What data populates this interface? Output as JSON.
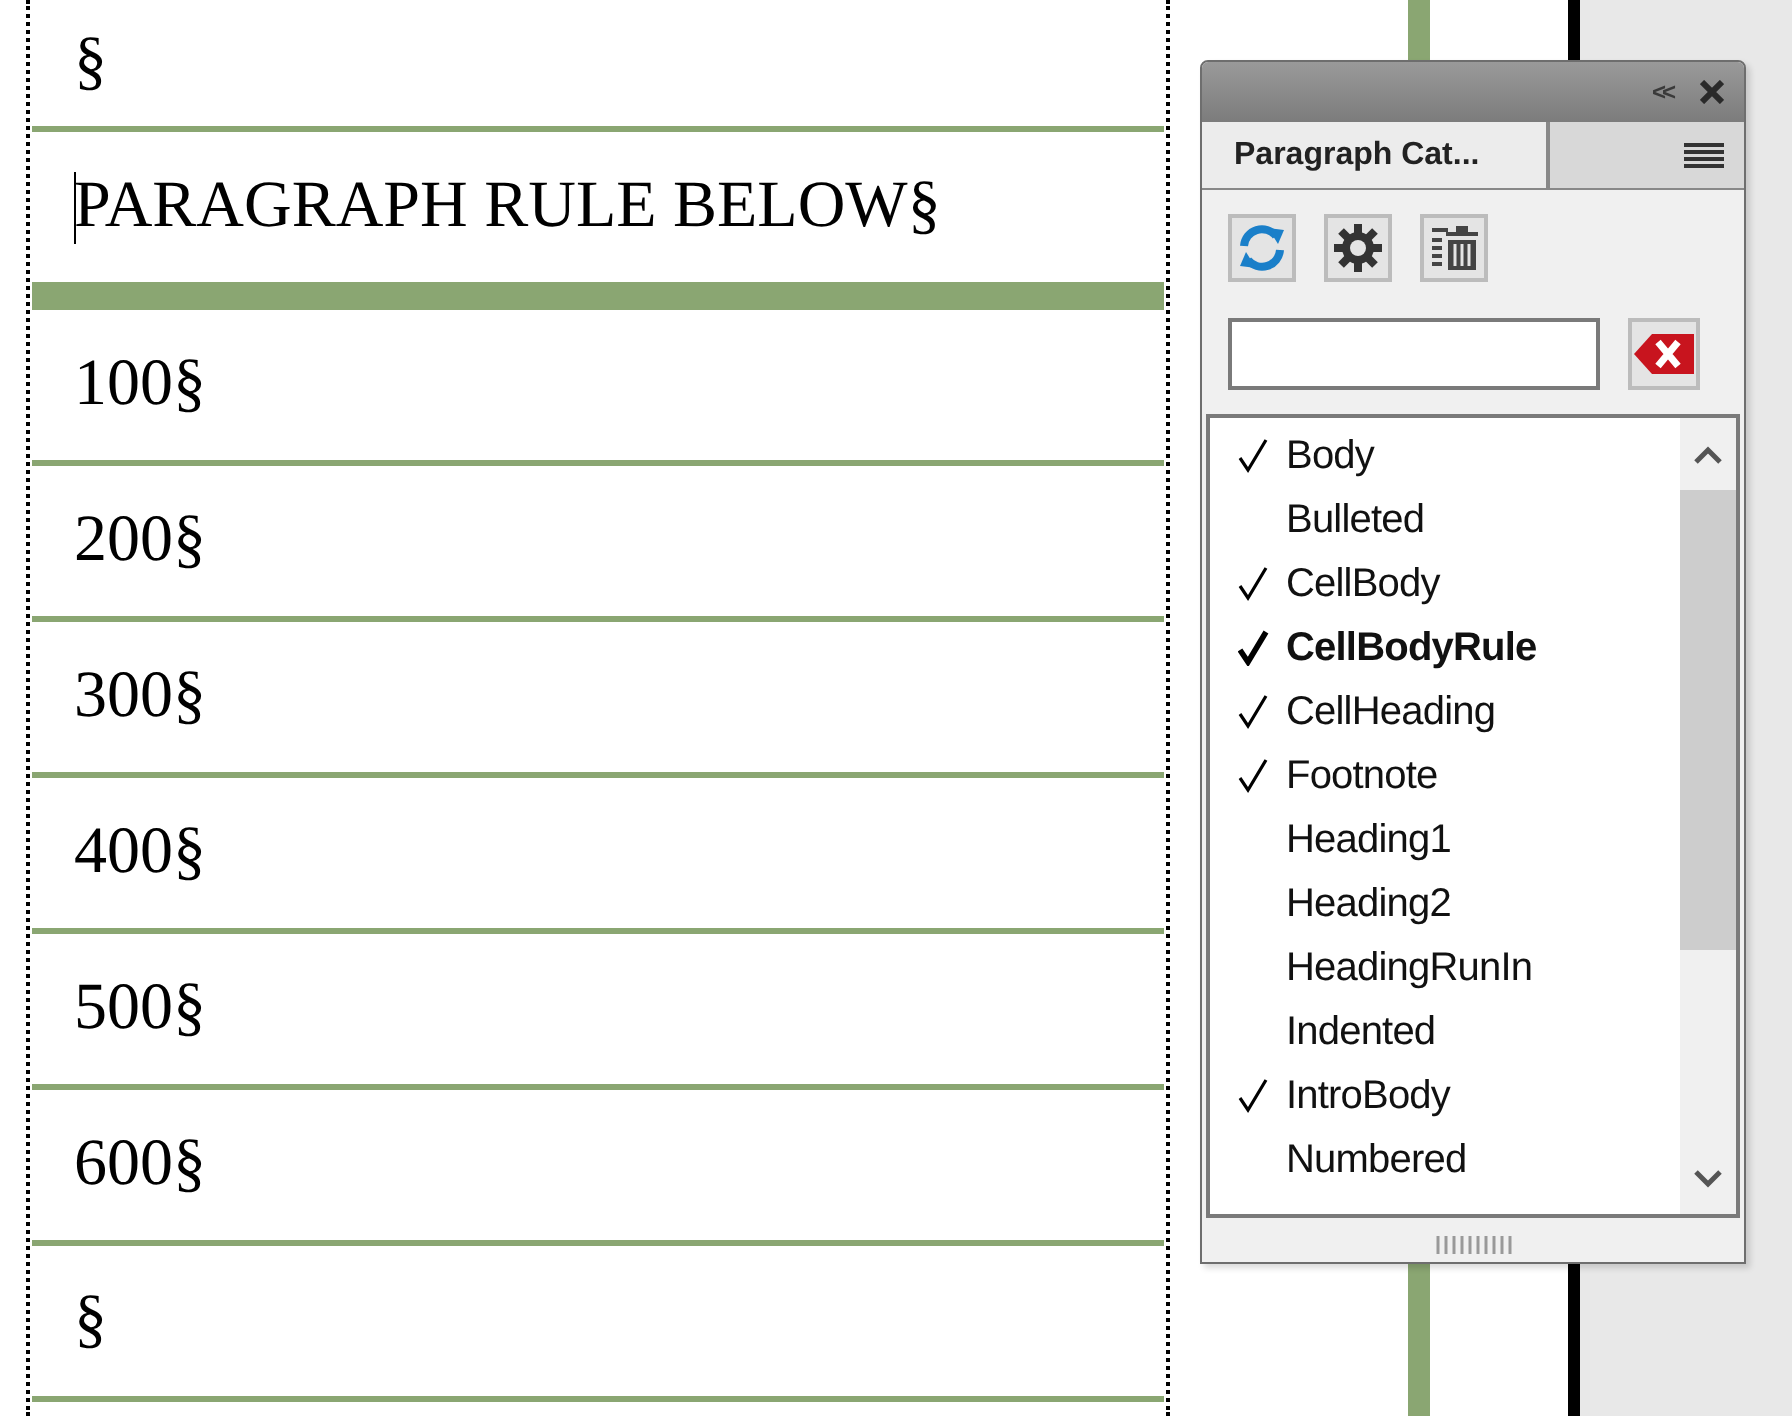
{
  "document": {
    "paragraphs": [
      {
        "text": "§",
        "thick_rule": false,
        "cursor": false
      },
      {
        "text": "PARAGRAPH RULE BELOW§",
        "thick_rule": true,
        "cursor": true
      },
      {
        "text": "100§",
        "thick_rule": false,
        "cursor": false
      },
      {
        "text": "200§",
        "thick_rule": false,
        "cursor": false
      },
      {
        "text": "300§",
        "thick_rule": false,
        "cursor": false
      },
      {
        "text": "400§",
        "thick_rule": false,
        "cursor": false
      },
      {
        "text": "500§",
        "thick_rule": false,
        "cursor": false
      },
      {
        "text": "600§",
        "thick_rule": false,
        "cursor": false
      },
      {
        "text": "§",
        "thick_rule": false,
        "cursor": false
      }
    ]
  },
  "panel": {
    "tab": "Paragraph Cat...",
    "collapse": "<<",
    "items": [
      {
        "label": "Body",
        "checked": true,
        "selected": false
      },
      {
        "label": "Bulleted",
        "checked": false,
        "selected": false
      },
      {
        "label": "CellBody",
        "checked": true,
        "selected": false
      },
      {
        "label": "CellBodyRule",
        "checked": true,
        "selected": true
      },
      {
        "label": "CellHeading",
        "checked": true,
        "selected": false
      },
      {
        "label": "Footnote",
        "checked": true,
        "selected": false
      },
      {
        "label": "Heading1",
        "checked": false,
        "selected": false
      },
      {
        "label": "Heading2",
        "checked": false,
        "selected": false
      },
      {
        "label": "HeadingRunIn",
        "checked": false,
        "selected": false
      },
      {
        "label": "Indented",
        "checked": false,
        "selected": false
      },
      {
        "label": "IntroBody",
        "checked": true,
        "selected": false
      },
      {
        "label": "Numbered",
        "checked": false,
        "selected": false
      }
    ]
  }
}
